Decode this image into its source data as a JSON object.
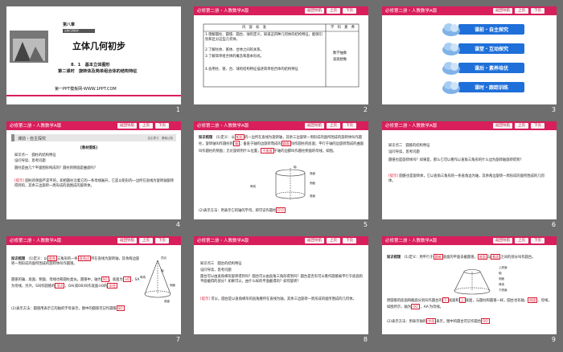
{
  "header": {
    "title": "必修第二册・人教数学A版",
    "nav_back": "返回导航",
    "nav_prev": "上页",
    "nav_next": "下页"
  },
  "slide_numbers": [
    "1",
    "2",
    "3",
    "4",
    "5",
    "6",
    "7",
    "8",
    "9"
  ],
  "slide1": {
    "chapter": "第八章",
    "chapter_sub": "立体几何初步",
    "title": "立体几何初步",
    "section": "8．1　基本立体图形",
    "lesson": "第二课时　旋转体及简单组合体的结构特征",
    "footer": "第一PPT模板网-WWW.1PPT.COM"
  },
  "slide2": {
    "col1": "内　容　标　准",
    "col2": "学　科　素　养",
    "rows": [
      "1.理解圆柱、圆锥、圆台、球的定义，知道这四种几何体的结构特征，能够识别和区分这些几何体。",
      "2.了解柱体、锥体、台体之间的关系。",
      "3.了解简单组合体的概念和基本形式。",
      "4.会用柱、锥、台、球的结构特征描述简单组合体的结构特征"
    ],
    "skills": [
      "数学抽象",
      "直观想象"
    ]
  },
  "slide3": {
    "items": [
      "课前・自主探究",
      "课堂・互动探究",
      "课后・素养培优",
      "课时・跟踪训练"
    ]
  },
  "slide4": {
    "section": "课前・自主探究",
    "right": "自主预习　基础认知",
    "subtitle": "[教材提炼]",
    "k1": "知识点一　圆柱的结构特征",
    "l1": "设问导读、思考问题",
    "q1": "圆柱是由几个平面图形构成的？圆柱的侧面是曲面吗？",
    "ans_tag": "[提示]",
    "ans": "圆柱的侧面不是平的，如把圆柱沿着它的一条母线展开，它是以矩形的一边所在直线为旋转轴旋转得到的，其余三边旋转一周形成的面围成的旋转体。"
  },
  "slide5": {
    "k": "知识梳理",
    "p1a": "(1)定义：以",
    "f1": "矩形",
    "p1b": "的一边所在直线为旋转轴，其余三边旋转一周形成的面所围成的旋转体叫作圆柱，旋转轴叫作圆柱的",
    "f2": "轴",
    "p1c": "；垂直于轴的边旋转而成的",
    "f3": "圆面",
    "p1d": "叫作圆柱的底面；平行于轴的边旋转而成的曲面叫作圆柱的侧面；无论旋转到什么位置，",
    "f4": "不垂直",
    "p1e": "于轴的边都叫作圆柱侧面的母线。如图。",
    "labels": [
      "轴",
      "底面",
      "侧面",
      "母线",
      "底面"
    ],
    "p2": "(2)表示方法：用表示它的轴的字母，即可记作圆柱",
    "f5": "O′O"
  },
  "slide6": {
    "k": "知识点二　圆锥的结构特征",
    "l": "设问导读，思考问题",
    "q": "圆锥也是旋转体吗？如果是，那么它可以看作以直角三角形的什么边为旋转轴旋转得到？",
    "tag": "[提示]",
    "a": "圆锥也是旋转体，它以直角三角形的一条直角边为轴，其余两边旋转一周形成的面所围成的几何体。"
  },
  "slide7": {
    "k": "知识梳理",
    "p1a": "(1)定义：以",
    "f1": "直角",
    "p1b": "三角形的一条",
    "f2": "直角边",
    "p1c": "所在直线为旋转轴，其余两边旋转一周形成的面所围成的旋转体叫作圆锥。",
    "p2": "圆锥的轴、底面、侧面、母线也和圆柱类似。",
    "p3a": "圆锥中，轴为",
    "f3": "SO",
    "p3b": "，底面为",
    "f4": "⊙O",
    "p3c": "，SA为母线，另外，S叫作圆锥的",
    "f5": "顶点",
    "p3d": "，OA(或OB)叫作底面⊙O的",
    "f6": "半径",
    "p4": "(2)表示方法：圆锥用表示它的轴的字母表示，图中的圆锥可记作圆锥",
    "f7": "SO",
    "labels": [
      "顶点",
      "轴",
      "母线",
      "侧面",
      "底面"
    ]
  },
  "slide8": {
    "k": "知识点三　圆台的结构特征",
    "l": "设问导读，思考问题",
    "q1": "圆台可以由直角梯形旋转得到吗？圆台可以由直角三角形得到吗？圆台是否有可以看作圆锥被平行于底面的平面截得的部分？如果可以，由什么样的平面截得的？如何旋转？",
    "tag": "[提示]",
    "a": "可以，圆台是以直角梯形的直角腰所在直线为轴，其余三边旋转一周形成的面所围成的几何体。"
  },
  "slide9": {
    "k": "知识梳理",
    "p1a": "(1)定义：用平行于",
    "f1": "圆锥",
    "p1b": "底面的平面去截圆锥，",
    "f2": "底面",
    "p1c": "与",
    "f3": "截面",
    "p1d": "之间的部分叫作圆台。",
    "labels": [
      "上底面",
      "轴",
      "侧面",
      "母线",
      "下底面"
    ],
    "p2a": "原圆锥的底面和截面分别叫作圆台的",
    "f4": "下",
    "p2b": "底面和",
    "f5": "上",
    "p2c": "底面，与圆柱和圆锥一样，圆台也有轴、",
    "f6": "侧面",
    "p2d": "、母线，如图所示，轴为",
    "f7": "OO′",
    "p2e": "，AA′为母线。",
    "p3": "(2)表示方法：用表示轴的",
    "f8": "字母",
    "p3b": "表示，图中的圆台可记作圆台",
    "f9": "OO′"
  }
}
